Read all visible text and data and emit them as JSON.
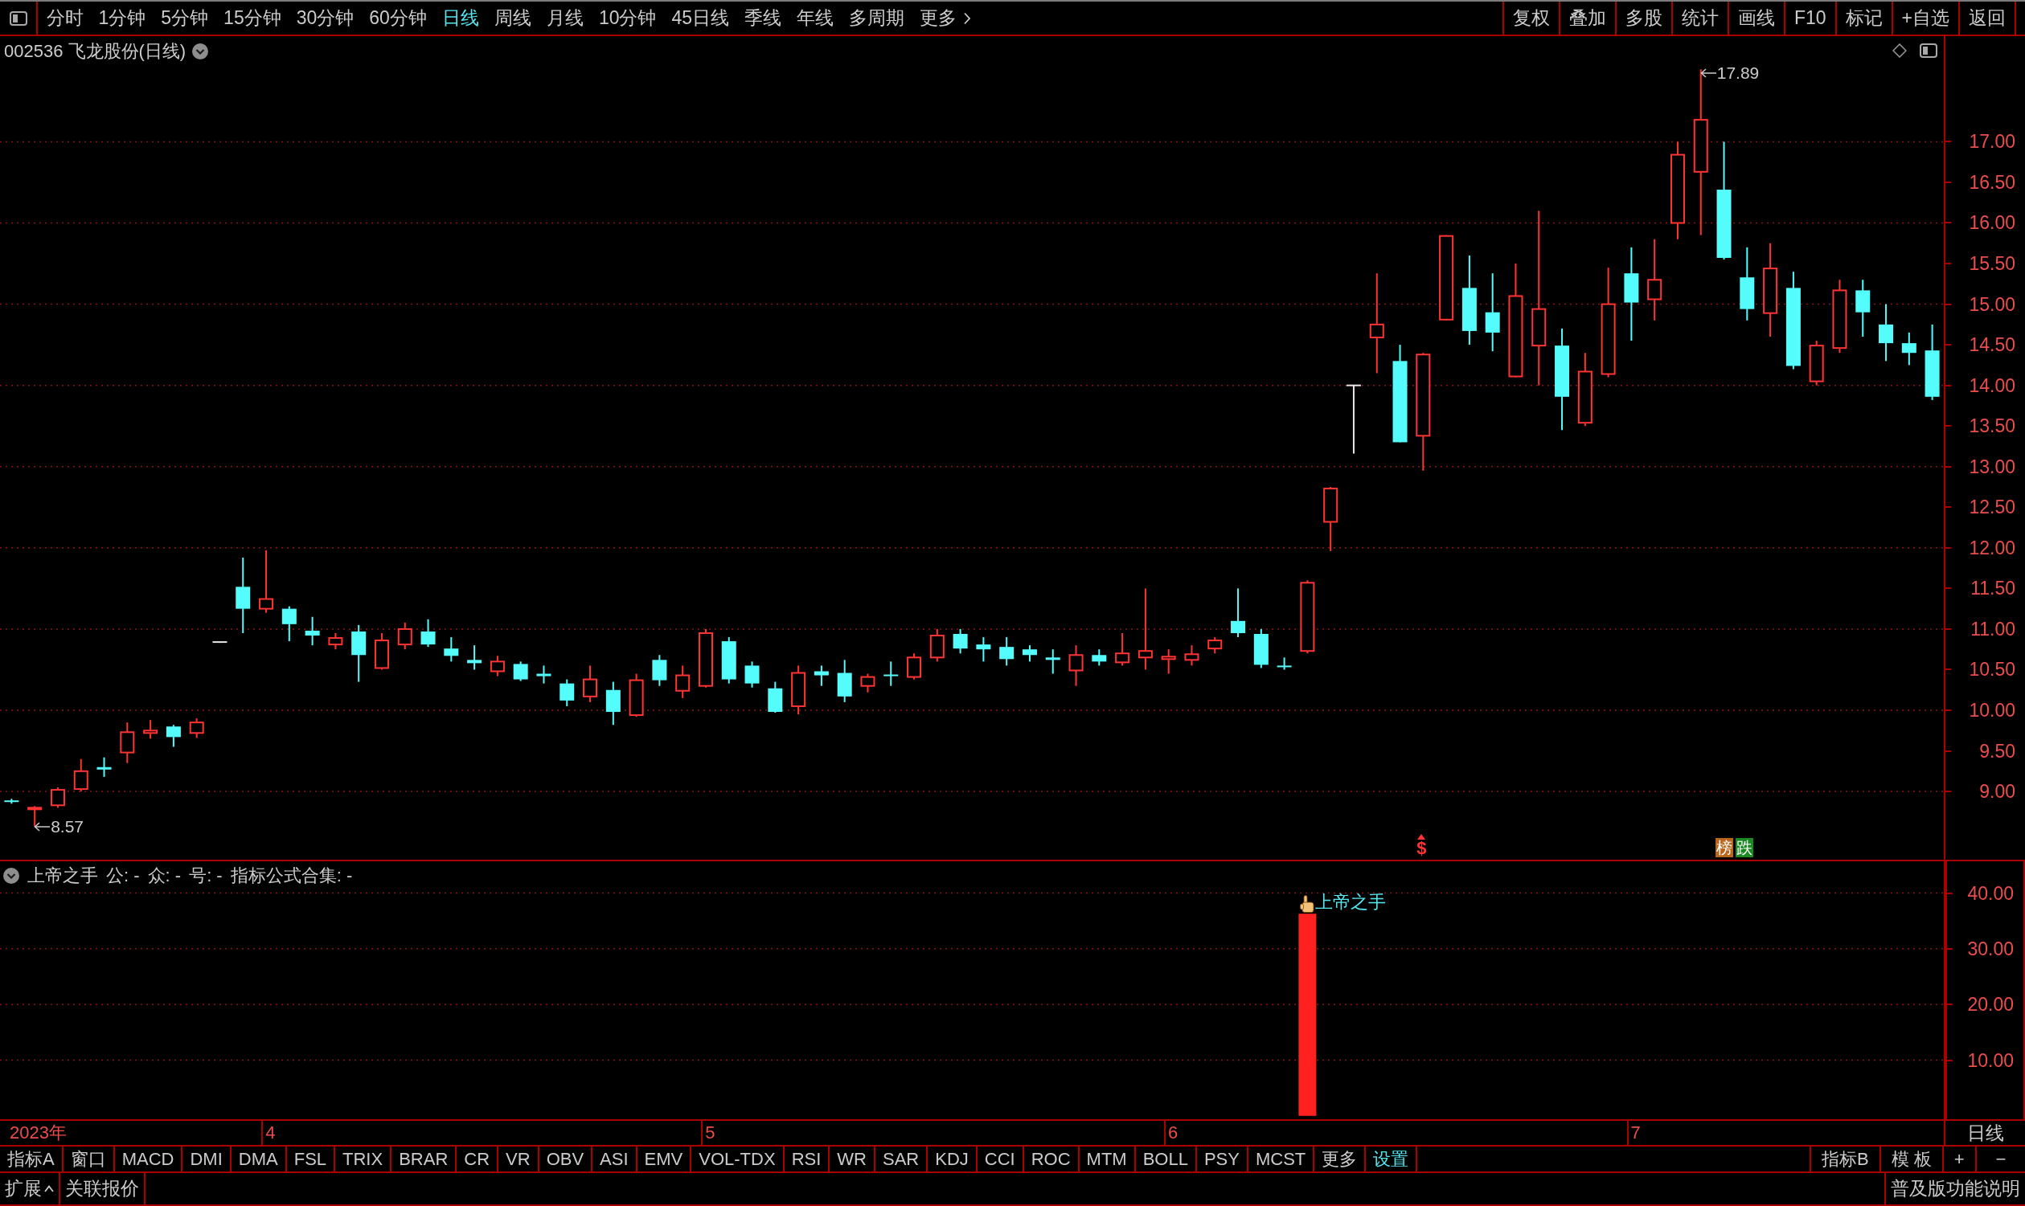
{
  "toolbar": {
    "periods": [
      {
        "label": "分时",
        "selected": false
      },
      {
        "label": "1分钟",
        "selected": false
      },
      {
        "label": "5分钟",
        "selected": false
      },
      {
        "label": "15分钟",
        "selected": false
      },
      {
        "label": "30分钟",
        "selected": false
      },
      {
        "label": "60分钟",
        "selected": false
      },
      {
        "label": "日线",
        "selected": true
      },
      {
        "label": "周线",
        "selected": false
      },
      {
        "label": "月线",
        "selected": false
      },
      {
        "label": "10分钟",
        "selected": false
      },
      {
        "label": "45日线",
        "selected": false
      },
      {
        "label": "季线",
        "selected": false
      },
      {
        "label": "年线",
        "selected": false
      },
      {
        "label": "多周期",
        "selected": false
      }
    ],
    "more": "更多",
    "actions": [
      "复权",
      "叠加",
      "多股",
      "统计",
      "画线",
      "F10",
      "标记",
      "+自选",
      "返回"
    ]
  },
  "main_chart": {
    "title": "002536 飞龙股份(日线)",
    "price_axis": [
      "17.00",
      "16.50",
      "16.00",
      "15.50",
      "15.00",
      "14.50",
      "14.00",
      "13.50",
      "13.00",
      "12.50",
      "12.00",
      "11.50",
      "11.00",
      "10.50",
      "10.00",
      "9.50",
      "9.00"
    ],
    "high_label": "17.89",
    "low_label": "8.57",
    "markers": [
      {
        "kind": "signal",
        "text": "$"
      },
      {
        "kind": "tag",
        "text": "榜",
        "color": "#b8661c"
      },
      {
        "kind": "tag",
        "text": "跌",
        "color": "#1c8a22"
      }
    ]
  },
  "indicator": {
    "name": "上帝之手",
    "outputs": [
      "公: -",
      "众: -",
      "号: -",
      "指标公式合集: -"
    ],
    "chart_data": {
      "type": "bar",
      "ylim": [
        -0.6,
        45.7
      ],
      "yticks": [
        {
          "value": 10,
          "label": "10.00"
        },
        {
          "value": 20,
          "label": "20.00"
        },
        {
          "value": 30,
          "label": "30.00"
        },
        {
          "value": 40,
          "label": "40.00"
        }
      ],
      "grid": true,
      "series": [
        {
          "name": "上帝之手",
          "color": "#ff2020",
          "values": [
            0,
            0,
            0,
            0,
            0,
            0,
            0,
            0,
            0,
            0,
            0,
            0,
            0,
            0,
            0,
            0,
            0,
            0,
            0,
            0,
            0,
            0,
            0,
            0,
            0,
            0,
            0,
            0,
            0,
            0,
            0,
            0,
            0,
            0,
            0,
            0,
            0,
            0,
            0,
            0,
            0,
            0,
            0,
            0,
            0,
            0,
            0,
            0,
            0,
            0,
            0,
            0,
            0,
            0,
            0,
            0,
            36.3,
            0,
            0,
            0,
            0,
            0,
            0,
            0,
            0,
            0,
            0,
            0,
            0,
            0,
            0,
            0,
            0,
            0,
            0,
            0,
            0,
            0,
            0,
            0,
            0,
            0,
            0,
            0
          ]
        }
      ]
    }
  },
  "date_axis": {
    "labels": [
      "2023年",
      "4",
      "5",
      "6",
      "7"
    ],
    "period_label": "日线"
  },
  "indicator_tabs": [
    {
      "label": "指标A",
      "kind": "indicator"
    },
    {
      "label": "窗口",
      "kind": "indicator"
    },
    {
      "label": "MACD",
      "kind": "indicator"
    },
    {
      "label": "DMI",
      "kind": "indicator"
    },
    {
      "label": "DMA",
      "kind": "indicator"
    },
    {
      "label": "FSL",
      "kind": "indicator"
    },
    {
      "label": "TRIX",
      "kind": "indicator"
    },
    {
      "label": "BRAR",
      "kind": "indicator"
    },
    {
      "label": "CR",
      "kind": "indicator"
    },
    {
      "label": "VR",
      "kind": "indicator"
    },
    {
      "label": "OBV",
      "kind": "indicator"
    },
    {
      "label": "ASI",
      "kind": "indicator"
    },
    {
      "label": "EMV",
      "kind": "indicator"
    },
    {
      "label": "VOL-TDX",
      "kind": "indicator"
    },
    {
      "label": "RSI",
      "kind": "indicator"
    },
    {
      "label": "WR",
      "kind": "indicator"
    },
    {
      "label": "SAR",
      "kind": "indicator"
    },
    {
      "label": "KDJ",
      "kind": "indicator"
    },
    {
      "label": "CCI",
      "kind": "indicator"
    },
    {
      "label": "ROC",
      "kind": "indicator"
    },
    {
      "label": "MTM",
      "kind": "indicator"
    },
    {
      "label": "BOLL",
      "kind": "indicator"
    },
    {
      "label": "PSY",
      "kind": "indicator"
    },
    {
      "label": "MCST",
      "kind": "indicator"
    },
    {
      "label": "更多",
      "kind": "indicator"
    },
    {
      "label": "设置",
      "kind": "settings"
    }
  ],
  "right_tabs": [
    "指标B",
    "模 板",
    "+",
    "−"
  ],
  "bottom_bar": {
    "expand": "扩展",
    "related_quotes": "关联报价",
    "help": "普及版功能说明"
  }
}
